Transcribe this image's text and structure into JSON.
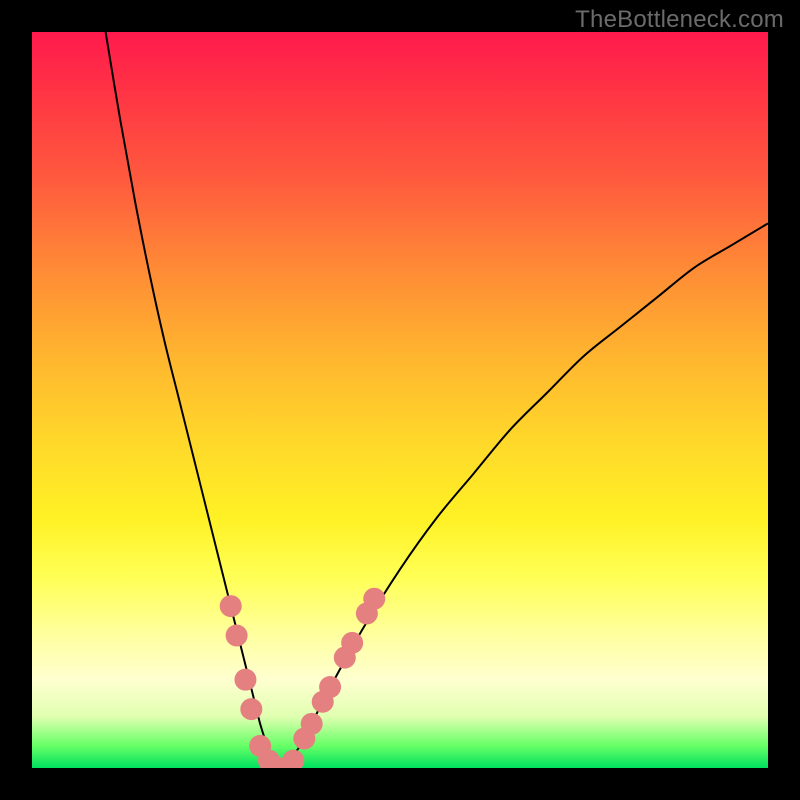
{
  "watermark": "TheBottleneck.com",
  "colors": {
    "background": "#000000",
    "curve": "#000000",
    "marker_fill": "#e58080",
    "marker_stroke": "#d46a6a"
  },
  "chart_data": {
    "type": "line",
    "title": "",
    "xlabel": "",
    "ylabel": "",
    "xlim": [
      0,
      100
    ],
    "ylim": [
      0,
      100
    ],
    "series": [
      {
        "name": "curve",
        "x": [
          10,
          12,
          14,
          16,
          18,
          20,
          22,
          24,
          26,
          28,
          29,
          30,
          31,
          32,
          33,
          34,
          35,
          37,
          40,
          45,
          50,
          55,
          60,
          65,
          70,
          75,
          80,
          85,
          90,
          95,
          100
        ],
        "values": [
          100,
          88,
          77,
          67,
          58,
          50,
          42,
          34,
          26,
          18,
          14,
          10,
          6,
          3,
          1,
          0,
          1,
          4,
          10,
          19,
          27,
          34,
          40,
          46,
          51,
          56,
          60,
          64,
          68,
          71,
          74
        ]
      }
    ],
    "markers": {
      "name": "highlighted-points",
      "points": [
        {
          "x": 27.0,
          "y": 22
        },
        {
          "x": 27.8,
          "y": 18
        },
        {
          "x": 29.0,
          "y": 12
        },
        {
          "x": 29.8,
          "y": 8
        },
        {
          "x": 31.0,
          "y": 3
        },
        {
          "x": 32.2,
          "y": 1
        },
        {
          "x": 33.3,
          "y": 0
        },
        {
          "x": 34.4,
          "y": 0
        },
        {
          "x": 35.5,
          "y": 1
        },
        {
          "x": 37.0,
          "y": 4
        },
        {
          "x": 38.0,
          "y": 6
        },
        {
          "x": 39.5,
          "y": 9
        },
        {
          "x": 40.5,
          "y": 11
        },
        {
          "x": 42.5,
          "y": 15
        },
        {
          "x": 43.5,
          "y": 17
        },
        {
          "x": 45.5,
          "y": 21
        },
        {
          "x": 46.5,
          "y": 23
        }
      ]
    }
  }
}
